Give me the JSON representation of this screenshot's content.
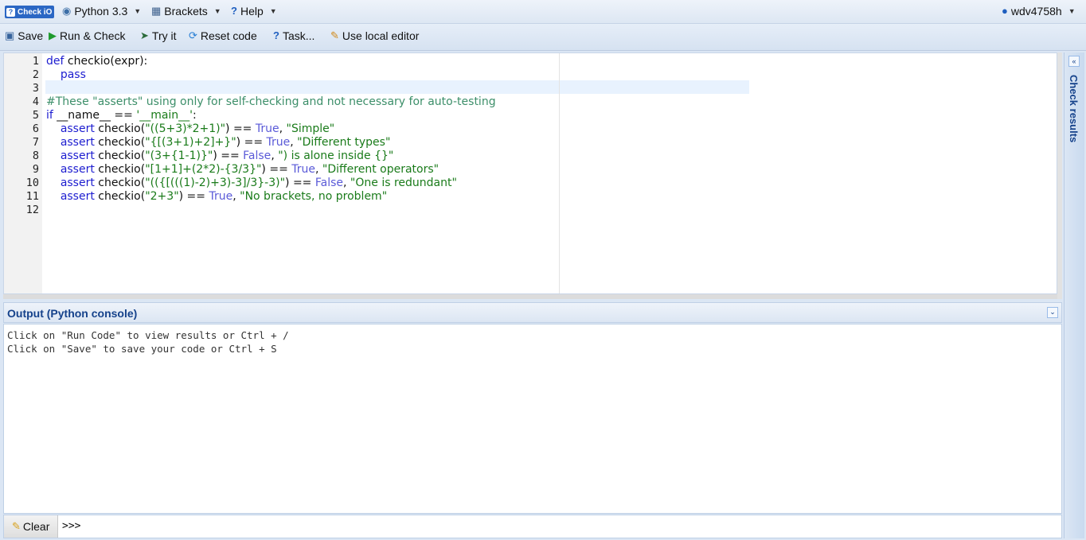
{
  "menubar": {
    "logo_text": "Check iO",
    "language": "Python 3.3",
    "mission": "Brackets",
    "help": "Help",
    "user": "wdv4758h"
  },
  "toolbar": {
    "save": "Save",
    "run_check": "Run & Check",
    "try_it": "Try it",
    "reset": "Reset code",
    "task": "Task...",
    "local_editor": "Use local editor"
  },
  "editor": {
    "line_numbers": [
      "1",
      "2",
      "3",
      "4",
      "5",
      "6",
      "7",
      "8",
      "9",
      "10",
      "11",
      "12"
    ],
    "lines": [
      "def checkio(expr):",
      "    pass",
      "",
      "#These \"asserts\" using only for self-checking and not necessary for auto-testing",
      "if __name__ == '__main__':",
      "    assert checkio(\"((5+3)*2+1)\") == True, \"Simple\"",
      "    assert checkio(\"{[(3+1)+2]+}\") == True, \"Different types\"",
      "    assert checkio(\"(3+{1-1)}\") == False, \") is alone inside {}\"",
      "    assert checkio(\"[1+1]+(2*2)-{3/3}\") == True, \"Different operators\"",
      "    assert checkio(\"(({[(((1)-2)+3)-3]/3}-3)\") == False, \"One is redundant\"",
      "    assert checkio(\"2+3\") == True, \"No brackets, no problem\"",
      ""
    ]
  },
  "output": {
    "title": "Output (Python console)",
    "lines": [
      "Click on \"Run Code\" to view results or Ctrl + /",
      "Click on \"Save\" to save your code or Ctrl + S"
    ],
    "clear_label": "Clear",
    "prompt": ">>>"
  },
  "side_panel": {
    "title": "Check results"
  },
  "colors": {
    "keyword": "#1d1dd0",
    "string": "#1a7b1a",
    "comment": "#3d8f6a",
    "boolean": "#5a5ad8",
    "panel_title": "#15428b"
  }
}
